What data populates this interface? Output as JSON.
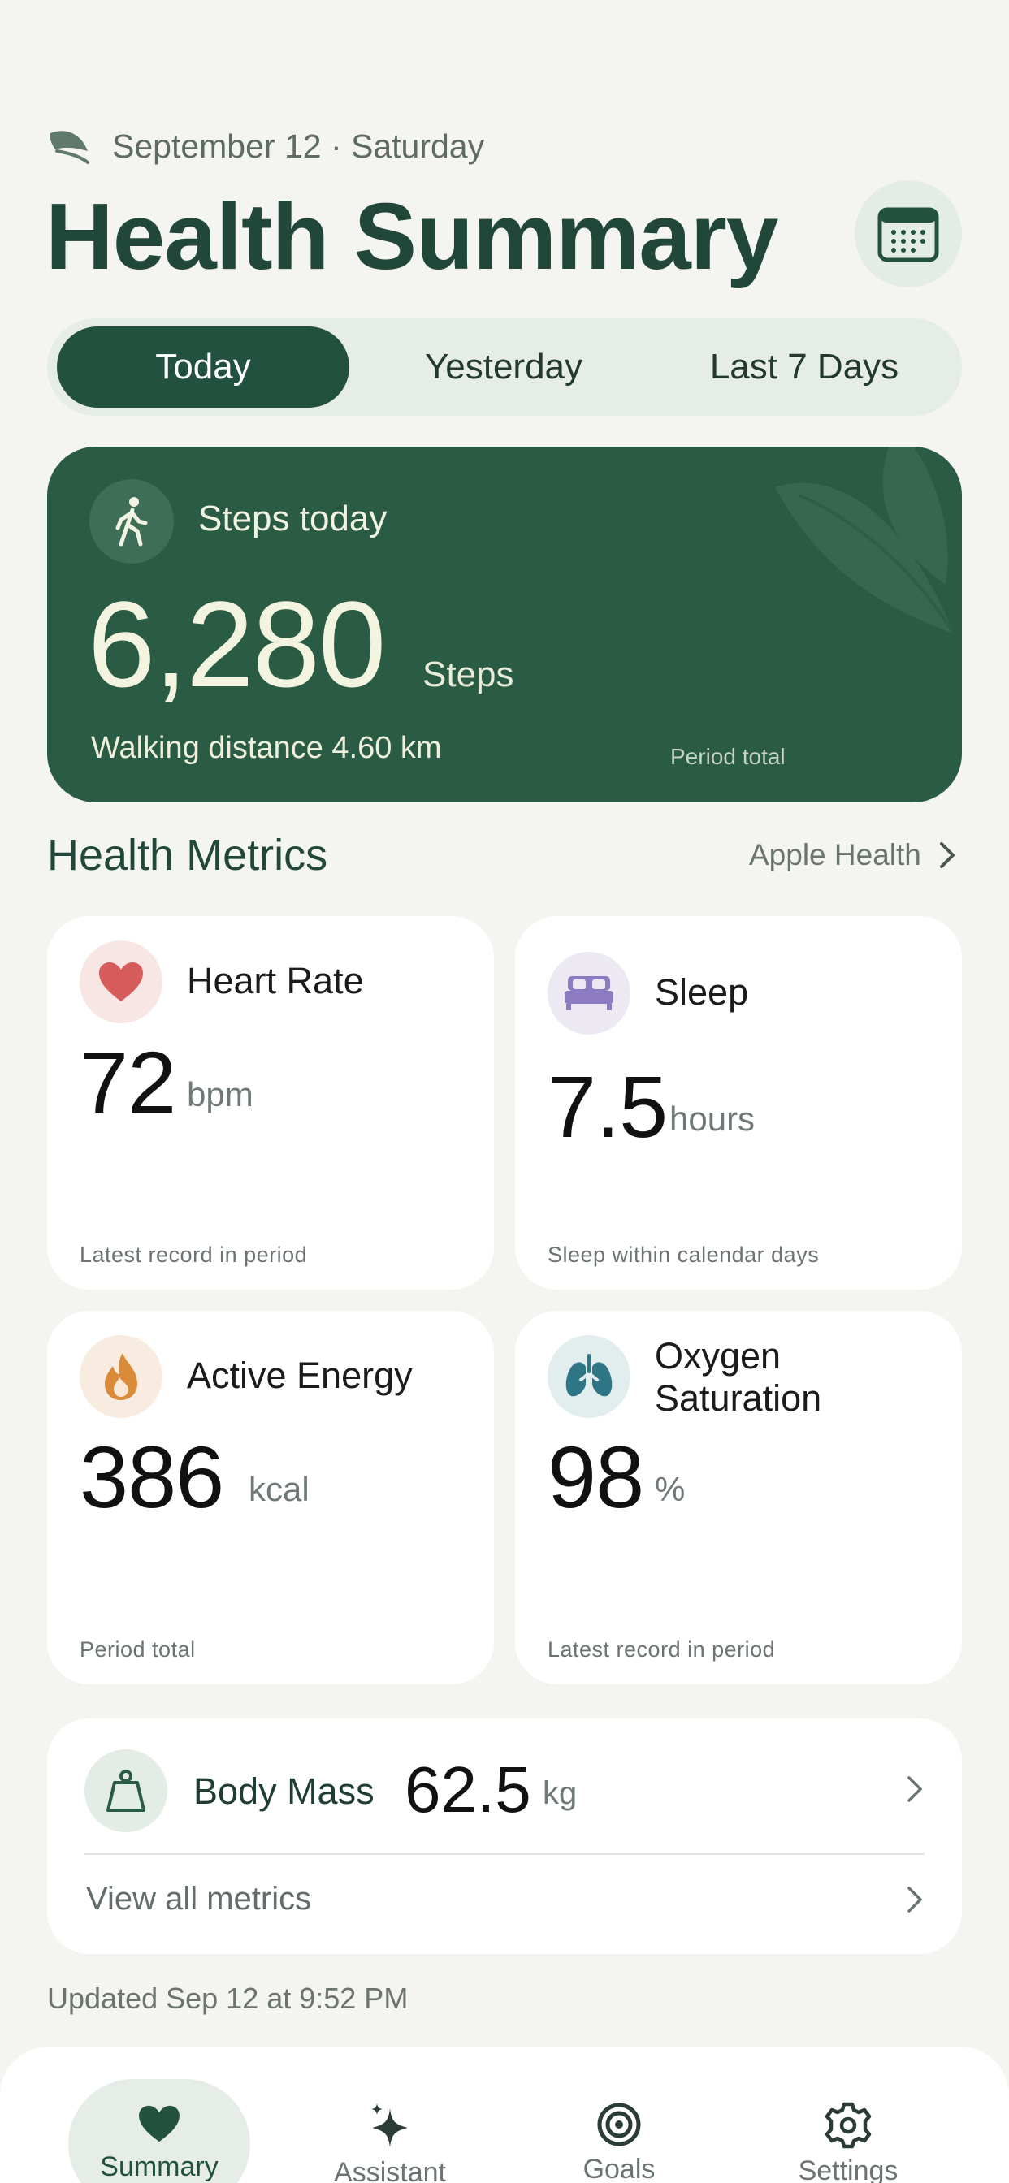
{
  "header": {
    "date": "September 12 · Saturday",
    "title": "Health Summary",
    "calendar_icon": "calendar-icon"
  },
  "segments": [
    {
      "label": "Today",
      "active": true
    },
    {
      "label": "Yesterday",
      "active": false
    },
    {
      "label": "Last 7 Days",
      "active": false
    }
  ],
  "steps": {
    "label": "Steps today",
    "value": "6,280",
    "unit": "Steps",
    "distance": "Walking distance 4.60 km",
    "period": "Period total"
  },
  "metrics_section": {
    "title": "Health Metrics",
    "link": "Apple Health"
  },
  "metrics": {
    "heart": {
      "title": "Heart Rate",
      "value": "72",
      "unit": "bpm",
      "foot": "Latest record in period",
      "color": "#d65c5c"
    },
    "sleep": {
      "title": "Sleep",
      "value": "7.5",
      "unit": "hours",
      "foot": "Sleep within calendar days",
      "color": "#8c7bc0"
    },
    "energy": {
      "title": "Active Energy",
      "value": "386",
      "unit": "kcal",
      "foot": "Period total",
      "color": "#d98b3a"
    },
    "oxygen": {
      "title_line1": "Oxygen",
      "title_line2": "Saturation",
      "value": "98",
      "unit": "%",
      "foot": "Latest record in period",
      "color": "#2e7685"
    }
  },
  "body_mass": {
    "title": "Body Mass",
    "value": "62.5",
    "unit": "kg",
    "view_all": "View all metrics"
  },
  "updated": "Updated Sep 12 at 9:52 PM",
  "tabs": [
    {
      "label": "Summary",
      "icon": "heart-icon",
      "active": true
    },
    {
      "label": "Assistant",
      "icon": "sparkle-icon",
      "active": false
    },
    {
      "label": "Goals",
      "icon": "target-icon",
      "active": false
    },
    {
      "label": "Settings",
      "icon": "gear-icon",
      "active": false
    }
  ],
  "colors": {
    "brand": "#22513f",
    "background": "#f4f4f0"
  }
}
